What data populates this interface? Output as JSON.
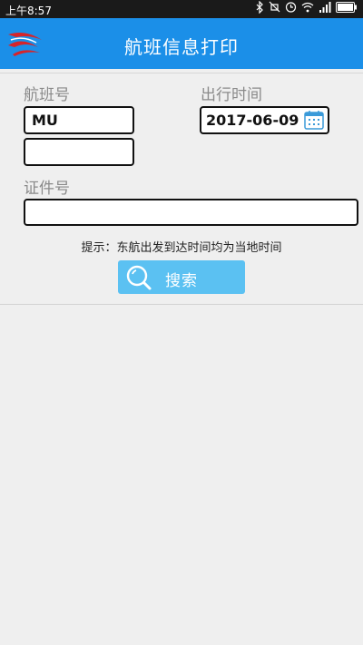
{
  "status_bar": {
    "time": "上午8:57",
    "icons": [
      "bluetooth-icon",
      "mute-icon",
      "alarm-icon",
      "wifi-icon",
      "signal-icon",
      "battery-icon"
    ]
  },
  "app_bar": {
    "title": "航班信息打印",
    "logo": "china-eastern-logo",
    "background_color": "#1b8fe8"
  },
  "form": {
    "flight_no_label": "航班号",
    "flight_no_value": "MU",
    "flight_no_suffix_value": "",
    "date_label": "出行时间",
    "date_value": "2017-06-09",
    "id_label": "证件号",
    "id_value": ""
  },
  "hint": "提示：东航出发到达时间均为当地时间",
  "search_button": {
    "label": "搜索",
    "icon": "search-icon",
    "color": "#5bc1f2"
  }
}
